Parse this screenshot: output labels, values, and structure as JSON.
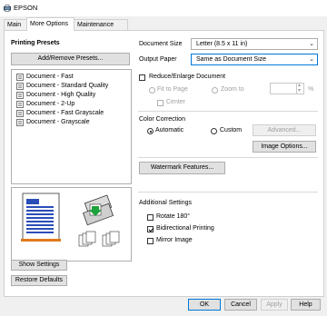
{
  "window": {
    "title": "EPSON"
  },
  "tabs": [
    {
      "label": "Main"
    },
    {
      "label": "More Options"
    },
    {
      "label": "Maintenance"
    }
  ],
  "presets": {
    "heading": "Printing Presets",
    "add_remove_label": "Add/Remove Presets...",
    "items": [
      "Document - Fast",
      "Document - Standard Quality",
      "Document - High Quality",
      "Document - 2-Up",
      "Document - Fast Grayscale",
      "Document - Grayscale"
    ]
  },
  "document_size": {
    "label": "Document Size",
    "value": "Letter (8.5 x 11 in)"
  },
  "output_paper": {
    "label": "Output Paper",
    "value": "Same as Document Size"
  },
  "reduce_enlarge": {
    "label": "Reduce/Enlarge Document",
    "checked": false,
    "fit_to_page": "Fit to Page",
    "zoom_to": "Zoom to",
    "percent": "%",
    "center": "Center"
  },
  "color_correction": {
    "heading": "Color Correction",
    "automatic": "Automatic",
    "custom": "Custom",
    "selected": "Automatic",
    "advanced_label": "Advanced...",
    "image_options_label": "Image Options..."
  },
  "watermark_label": "Watermark Features...",
  "additional": {
    "heading": "Additional Settings",
    "rotate": {
      "label": "Rotate 180°",
      "checked": false
    },
    "bidirectional": {
      "label": "Bidirectional Printing",
      "checked": true
    },
    "mirror": {
      "label": "Mirror Image",
      "checked": false
    }
  },
  "show_settings_label": "Show Settings",
  "restore_defaults_label": "Restore Defaults",
  "footer": {
    "ok": "OK",
    "cancel": "Cancel",
    "apply": "Apply",
    "help": "Help"
  },
  "colors": {
    "accent": "#0078d7",
    "button_bg": "#e1e1e1",
    "panel_bg": "#ffffff",
    "window_bg": "#f0f0f0"
  }
}
